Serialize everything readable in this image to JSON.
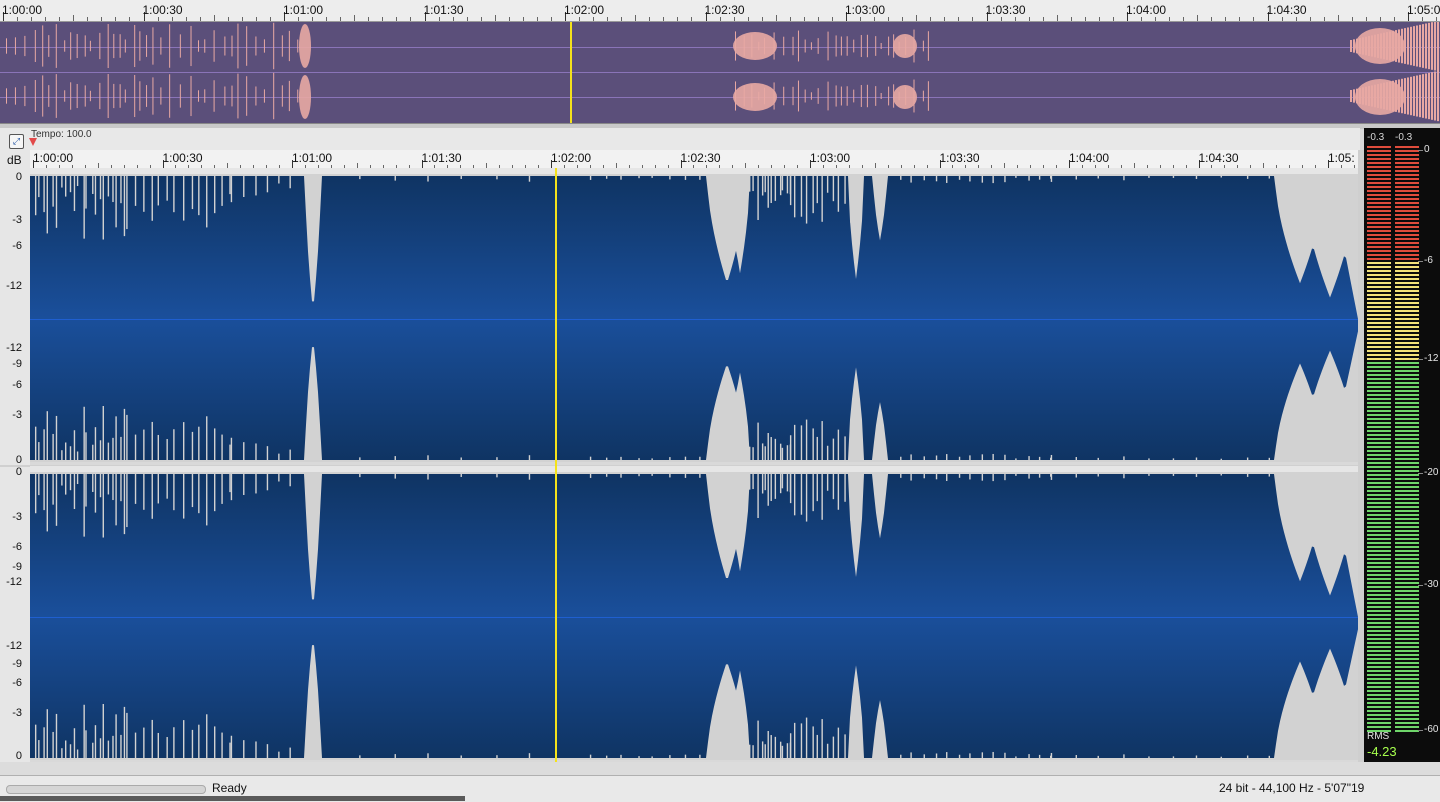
{
  "overview": {
    "ruler_labels": [
      "1:00:00",
      "1:00:30",
      "1:01:00",
      "1:01:30",
      "1:02:00",
      "1:02:30",
      "1:03:00",
      "1:03:30",
      "1:04:00",
      "1:04:30",
      "1:05:0"
    ],
    "wave_color": "#e8a8a3",
    "bg_color": "#5b4f7a"
  },
  "editor": {
    "tempo_label": "Tempo: 100.0",
    "db_header": "dB",
    "ruler_labels": [
      "1:00:00",
      "1:00:30",
      "1:01:00",
      "1:01:30",
      "1:02:00",
      "1:02:30",
      "1:03:00",
      "1:03:30",
      "1:04:00",
      "1:04:30",
      "1:05:"
    ],
    "db_scale": [
      "0",
      "-3",
      "-6",
      "-12",
      "-12",
      "-9",
      "-6",
      "-3",
      "0"
    ],
    "db_scale_ch2": [
      "0",
      "-3",
      "-6",
      "-9",
      "-12",
      "-12",
      "-9",
      "-6",
      "-3",
      "0"
    ],
    "wave_color": "#d2d2d2",
    "bg_top_color": "#0f3463",
    "bg_mid_color": "#1a4f9b",
    "cursor_color": "#f4e21b"
  },
  "meters": {
    "peak_left": "-0.3",
    "peak_right": "-0.3",
    "scale": [
      "0",
      "-6",
      "-12",
      "-20",
      "-30",
      "-60"
    ],
    "rms_label": "RMS",
    "rms_value": "-4.23",
    "red": "#e04c3c",
    "yellow": "#f3e27a",
    "green": "#6fd66a"
  },
  "status": {
    "text": "Ready",
    "format": "24 bit - 44,100 Hz - 5'07\"19"
  }
}
